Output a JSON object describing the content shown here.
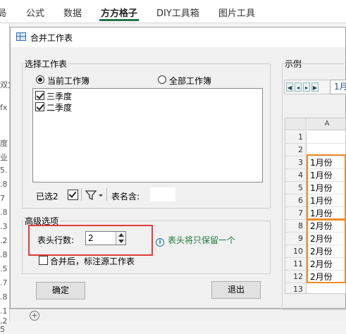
{
  "ribbon": {
    "tabs": [
      {
        "label": "局"
      },
      {
        "label": "公式"
      },
      {
        "label": "数据"
      },
      {
        "label": "方方格子"
      },
      {
        "label": "DIY工具箱"
      },
      {
        "label": "图片工具"
      }
    ],
    "active_tab": "方方格子"
  },
  "excel_left": {
    "fragments": [
      "双文",
      "fx",
      "度",
      "业",
      "5.",
      ".8",
      "7",
      ".8",
      ".3",
      ".2",
      ".8",
      ".5",
      ".7",
      ".8",
      ".1",
      ".2",
      "5"
    ]
  },
  "dialog": {
    "title": "合并工作表",
    "select_group": {
      "label": "选择工作表",
      "radio_current": "当前工作簿",
      "radio_all": "全部工作簿",
      "selected_radio": "当前工作簿",
      "sheets": [
        {
          "label": "三季度",
          "checked": true
        },
        {
          "label": "二季度",
          "checked": true
        }
      ],
      "selected_count": "已选2",
      "table_name_label": "表名含:",
      "table_name_value": ""
    },
    "advanced_group": {
      "label": "高级选项",
      "header_rows_label": "表头行数:",
      "header_rows_value": "2",
      "info_text": "表头将只保留一个",
      "mark_source_label": "合并后，标注源工作表",
      "mark_source_checked": false
    },
    "buttons": {
      "ok": "确定",
      "exit": "退出"
    },
    "preview": {
      "label": "示例",
      "tab_label": "1月",
      "column_header": "A",
      "rows": [
        {
          "num": "1",
          "value": ""
        },
        {
          "num": "2",
          "value": ""
        },
        {
          "num": "3",
          "value": "1月份"
        },
        {
          "num": "4",
          "value": "1月份"
        },
        {
          "num": "5",
          "value": "1月份"
        },
        {
          "num": "6",
          "value": "1月份"
        },
        {
          "num": "7",
          "value": "1月份"
        },
        {
          "num": "8",
          "value": "2月份"
        },
        {
          "num": "9",
          "value": "2月份"
        },
        {
          "num": "10",
          "value": "2月份"
        },
        {
          "num": "11",
          "value": "2月份"
        },
        {
          "num": "12",
          "value": "2月份"
        },
        {
          "num": "13",
          "value": ""
        }
      ]
    }
  },
  "colors": {
    "accent_green": "#217346",
    "highlight_red": "#e23b3b",
    "highlight_orange": "#f08a24",
    "info_green": "#1f7a3a"
  }
}
